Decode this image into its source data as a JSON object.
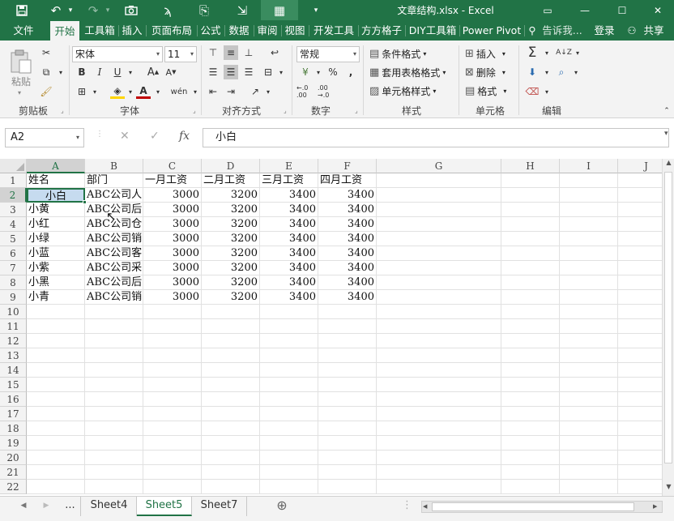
{
  "title": "文章结构.xlsx - Excel",
  "quick_access": {
    "save": "save-icon",
    "undo": "undo-icon",
    "redo": "redo-icon",
    "camera": "camera-icon",
    "brush": "format-painter-icon",
    "paste_special": "paste-icon",
    "login_tool": "login-icon",
    "table_tool": "table-icon",
    "customize": "▾"
  },
  "window": {
    "ribbon_opt": "▭",
    "min": "—",
    "max": "☐",
    "close": "✕"
  },
  "tabs": [
    "文件",
    "开始",
    "工具箱",
    "插入",
    "页面布局",
    "公式",
    "数据",
    "审阅",
    "视图",
    "开发工具",
    "方方格子",
    "DIY工具箱",
    "Power Pivot"
  ],
  "active_tab": "开始",
  "tell_me": "告诉我...",
  "login": "登录",
  "share": "共享",
  "ribbon": {
    "clipboard": {
      "label": "剪贴板",
      "paste": "粘贴"
    },
    "font": {
      "label": "字体",
      "name": "宋体",
      "size": "11",
      "bold": "B",
      "italic": "I",
      "underline": "U",
      "grow": "A",
      "shrink": "A",
      "wen": "wén"
    },
    "alignment": {
      "label": "对齐方式"
    },
    "number": {
      "label": "数字",
      "format": "常规",
      "percent": "%",
      "comma": ",",
      "dec_inc": "←.0 .00",
      "dec_dec": ".00 →.0"
    },
    "styles": {
      "label": "样式",
      "cond": "条件格式",
      "table": "套用表格格式",
      "cell": "单元格样式"
    },
    "cells": {
      "label": "单元格",
      "insert": "插入",
      "delete": "删除",
      "format": "格式"
    },
    "editing": {
      "label": "编辑",
      "sum": "Σ",
      "sort": "A↓Z",
      "find": "⌕",
      "clear": "⌫"
    }
  },
  "formula_bar": {
    "name_box": "A2",
    "cancel": "✕",
    "confirm": "✓",
    "fx": "fx",
    "content": "小白"
  },
  "columns": [
    "A",
    "B",
    "C",
    "D",
    "E",
    "F",
    "G",
    "H",
    "I",
    "J"
  ],
  "rows": [
    "1",
    "2",
    "3",
    "4",
    "5",
    "6",
    "7",
    "8",
    "9",
    "10",
    "11",
    "12",
    "13",
    "14",
    "15",
    "16",
    "17",
    "18",
    "19",
    "20",
    "21",
    "22"
  ],
  "cells": [
    [
      "姓名",
      "部门",
      "一月工资",
      "二月工资",
      "三月工资",
      "四月工资"
    ],
    [
      "小白",
      "ABC公司人",
      "3000",
      "3200",
      "3400",
      "3400"
    ],
    [
      "小黄",
      "ABC公司后",
      "3000",
      "3200",
      "3400",
      "3400"
    ],
    [
      "小红",
      "ABC公司仓",
      "3000",
      "3200",
      "3400",
      "3400"
    ],
    [
      "小绿",
      "ABC公司销",
      "3000",
      "3200",
      "3400",
      "3400"
    ],
    [
      "小蓝",
      "ABC公司客",
      "3000",
      "3200",
      "3400",
      "3400"
    ],
    [
      "小紫",
      "ABC公司采",
      "3000",
      "3200",
      "3400",
      "3400"
    ],
    [
      "小黑",
      "ABC公司后",
      "3000",
      "3200",
      "3400",
      "3400"
    ],
    [
      "小青",
      "ABC公司销",
      "3000",
      "3200",
      "3400",
      "3400"
    ]
  ],
  "selected_cell": "A2",
  "sheets": [
    "Sheet4",
    "Sheet5",
    "Sheet7"
  ],
  "active_sheet": "Sheet5",
  "sheet_nav": {
    "prev": "◀",
    "next": "▶",
    "more": "...",
    "add": "⊕"
  },
  "colors": {
    "brand": "#217346",
    "selection": "#c6dbef",
    "ribbon_bg": "#f3f3f3"
  }
}
